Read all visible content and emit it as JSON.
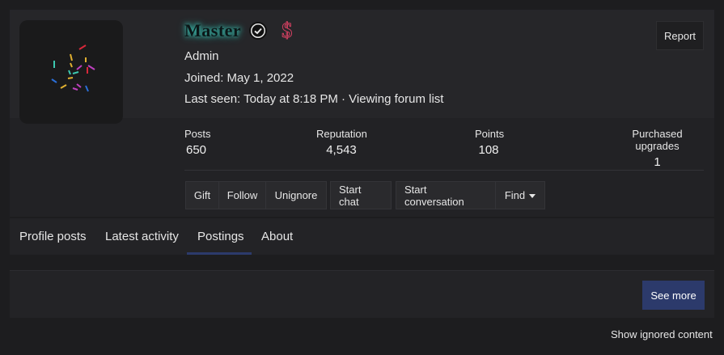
{
  "profile": {
    "username": "Master",
    "role": "Admin",
    "joined": "Joined: May 1, 2022",
    "last_seen": "Last seen: Today at 8:18 PM · Viewing forum list",
    "badge_icon": "verified-check-icon",
    "upgrade_icon": "dollar-sign-icon",
    "username_glow_color": "#3fd0c0"
  },
  "report_button": "Report",
  "stats": {
    "posts_label": "Posts",
    "posts_value": "650",
    "reputation_label": "Reputation",
    "reputation_value": "4,543",
    "points_label": "Points",
    "points_value": "108",
    "upgrades_label": "Purchased upgrades",
    "upgrades_value": "1"
  },
  "actions": {
    "gift": "Gift",
    "follow": "Follow",
    "unignore": "Unignore",
    "start_chat": "Start chat",
    "start_conversation": "Start conversation",
    "find": "Find"
  },
  "tabs": [
    {
      "label": "Profile posts"
    },
    {
      "label": "Latest activity"
    },
    {
      "label": "Postings",
      "active": true
    },
    {
      "label": "About"
    }
  ],
  "see_more": "See more",
  "show_ignored": "Show ignored content",
  "colors": {
    "background": "#1d1d1f",
    "card": "#232326",
    "accent": "#2c3a6b"
  }
}
